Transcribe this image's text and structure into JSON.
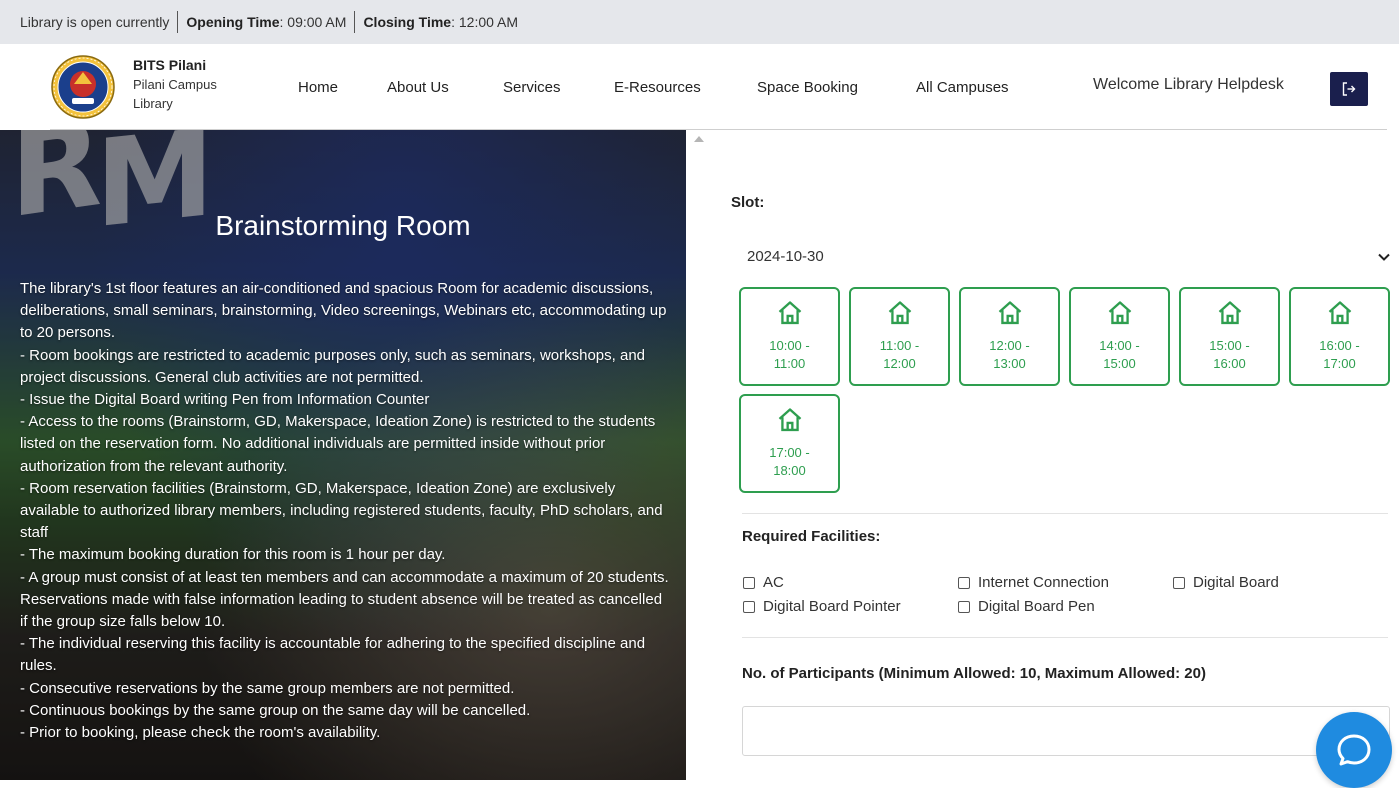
{
  "topbar": {
    "status": "Library is open currently",
    "opening_label": "Opening Time",
    "opening_value": ": 09:00 AM",
    "closing_label": "Closing Time",
    "closing_value": ": 12:00 AM"
  },
  "header": {
    "brand_line1": "BITS Pilani",
    "brand_line2": "Pilani Campus",
    "brand_line3": "Library",
    "nav": [
      "Home",
      "About Us",
      "Services",
      "E-Resources",
      "Space Booking",
      "All Campuses"
    ],
    "welcome": "Welcome Library Helpdesk",
    "logout_icon": "logout-icon"
  },
  "room": {
    "title": "Brainstorming Room",
    "description": [
      "The library's 1st floor features an air-conditioned and spacious Room for academic discussions, deliberations, small seminars, brainstorming, Video screenings, Webinars etc, accommodating up to 20 persons.",
      "- Room bookings are restricted to academic purposes only, such as seminars, workshops, and project discussions. General club activities are not permitted.",
      "- Issue the Digital Board writing Pen from Information Counter",
      "- Access to the rooms (Brainstorm, GD, Makerspace, Ideation Zone) is restricted to the students listed on the reservation form. No additional individuals are permitted inside without prior authorization from the relevant authority.",
      "- Room reservation facilities (Brainstorm, GD, Makerspace, Ideation Zone) are exclusively available to authorized library members, including registered students, faculty, PhD scholars, and staff",
      "- The maximum booking duration for this room is 1 hour per day.",
      "- A group must consist of at least ten members and can accommodate a maximum of 20 students. Reservations made with false information leading to student absence will be treated as cancelled if the group size falls below 10.",
      "- The individual reserving this facility is accountable for adhering to the specified discipline and rules.",
      "- Consecutive reservations by the same group members are not permitted.",
      "- Continuous bookings by the same group on the same day will be cancelled.",
      "- Prior to booking, please check the room's availability."
    ]
  },
  "booking": {
    "slot_label": "Slot:",
    "date_value": "2024-10-30",
    "slots": [
      {
        "start": "10:00 -",
        "end": "11:00"
      },
      {
        "start": "11:00 -",
        "end": "12:00"
      },
      {
        "start": "12:00 -",
        "end": "13:00"
      },
      {
        "start": "14:00 -",
        "end": "15:00"
      },
      {
        "start": "15:00 -",
        "end": "16:00"
      },
      {
        "start": "16:00 -",
        "end": "17:00"
      },
      {
        "start": "17:00 -",
        "end": "18:00"
      }
    ],
    "facilities_label": "Required Facilities:",
    "facilities": [
      "AC",
      "Internet Connection",
      "Digital Board",
      "Digital Board Pointer",
      "Digital Board Pen"
    ],
    "participants_label": "No. of Participants (Minimum Allowed: 10, Maximum Allowed: 20)",
    "participants_value": ""
  },
  "colors": {
    "slot_green": "#2e9e4f",
    "logout_bg": "#1a1f4d",
    "chat_blue": "#1f8be0",
    "topbar_bg": "#e5e7eb"
  }
}
